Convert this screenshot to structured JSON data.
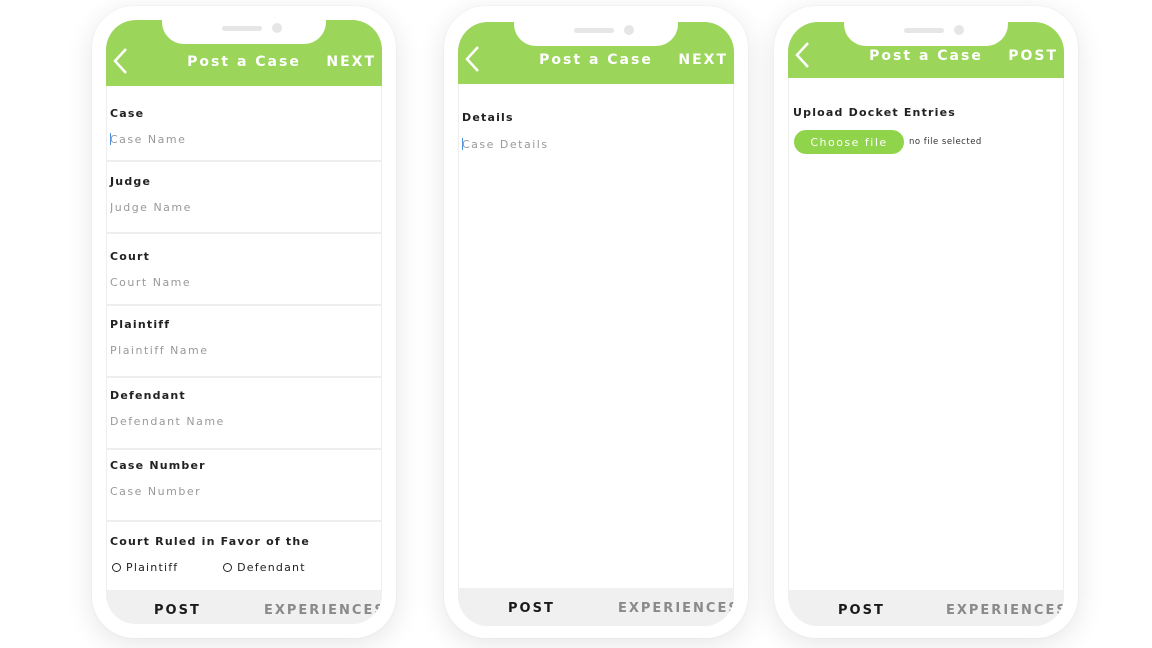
{
  "screens": [
    {
      "header": {
        "title": "Post a Case",
        "action": "NEXT"
      },
      "fields": [
        {
          "label": "Case",
          "placeholder": "Case Name"
        },
        {
          "label": "Judge",
          "placeholder": "Judge Name"
        },
        {
          "label": "Court",
          "placeholder": "Court Name"
        },
        {
          "label": "Plaintiff",
          "placeholder": "Plaintiff Name"
        },
        {
          "label": "Defendant",
          "placeholder": "Defendant Name"
        },
        {
          "label": "Case Number",
          "placeholder": "Case Number"
        }
      ],
      "ruling": {
        "label": "Court Ruled in Favor of the",
        "options": [
          "Plaintiff",
          "Defendant"
        ]
      },
      "tabs": {
        "active": "POST",
        "inactive": "EXPERIENCES"
      }
    },
    {
      "header": {
        "title": "Post a Case",
        "action": "NEXT"
      },
      "details": {
        "label": "Details",
        "placeholder": "Case Details"
      },
      "tabs": {
        "active": "POST",
        "inactive": "EXPERIENCES"
      }
    },
    {
      "header": {
        "title": "Post a Case",
        "action": "POST"
      },
      "upload": {
        "label": "Upload Docket Entries",
        "button": "Choose file",
        "status": "no file selected"
      },
      "tabs": {
        "active": "POST",
        "inactive": "EXPERIENCES"
      }
    }
  ],
  "colors": {
    "accent": "#9bd65a",
    "tab_bar": "#f0f0f0",
    "inactive_tab": "#8a8a8a"
  }
}
